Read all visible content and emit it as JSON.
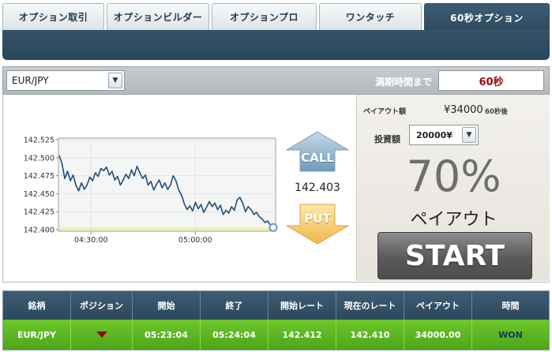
{
  "tabs": [
    {
      "label": "オプション取引"
    },
    {
      "label": "オプションビルダー"
    },
    {
      "label": "オプションプロ"
    },
    {
      "label": "ワンタッチ"
    },
    {
      "label": "60秒オプション",
      "active": true
    }
  ],
  "toolbar": {
    "symbol": "EUR/JPY",
    "expiry_label": "満期時間まで",
    "expiry_value": "60秒"
  },
  "chart": {
    "current_rate": "142.403",
    "call_label": "CALL",
    "put_label": "PUT"
  },
  "chart_data": {
    "type": "line",
    "title": "",
    "xlabel": "",
    "ylabel": "",
    "ylim": [
      142.4,
      142.525
    ],
    "yticks": [
      "142.525",
      "142.500",
      "142.475",
      "142.450",
      "142.425",
      "142.400"
    ],
    "xticks": [
      "04:30:00",
      "05:00:00"
    ],
    "grid": true,
    "series": [
      {
        "values": [
          142.503,
          142.492,
          142.471,
          142.481,
          142.468,
          142.476,
          142.462,
          142.454,
          142.465,
          142.456,
          142.462,
          142.473,
          142.468,
          142.479,
          142.474,
          142.485,
          142.482,
          142.487,
          142.476,
          142.481,
          142.469,
          142.474,
          142.462,
          142.469,
          142.477,
          142.471,
          142.483,
          142.475,
          142.488,
          142.479,
          142.471,
          142.476,
          142.462,
          142.467,
          142.455,
          142.463,
          142.469,
          142.458,
          142.465,
          142.456,
          142.462,
          142.475,
          142.468,
          142.455,
          142.448,
          142.436,
          142.428,
          142.433,
          142.426,
          142.438,
          142.429,
          142.435,
          142.424,
          142.431,
          142.439,
          142.432,
          142.437,
          142.428,
          142.434,
          142.421,
          142.427,
          142.423,
          142.432,
          142.427,
          142.441,
          142.445,
          142.437,
          142.425,
          142.432,
          142.428,
          142.421,
          142.424,
          142.418,
          142.415,
          142.41,
          142.412,
          142.406,
          142.403
        ]
      }
    ]
  },
  "payout": {
    "label": "ペイアウト額",
    "amount": "¥34000",
    "suffix": "60秒後"
  },
  "investment": {
    "label": "投資額",
    "value": "20000¥"
  },
  "payout_rate": {
    "percent": "70%",
    "caption": "ペイアウト"
  },
  "start_label": "START",
  "table": {
    "headers": [
      "銘柄",
      "ポジション",
      "開始",
      "終了",
      "開始レート",
      "現在のレート",
      "ペイアウト",
      "時間"
    ],
    "row": {
      "symbol": "EUR/JPY",
      "position": "down-arrow",
      "start": "05:23:04",
      "end": "05:24:04",
      "start_rate": "142.412",
      "current_rate": "142.410",
      "payout": "34000.00",
      "result": "WON"
    }
  }
}
